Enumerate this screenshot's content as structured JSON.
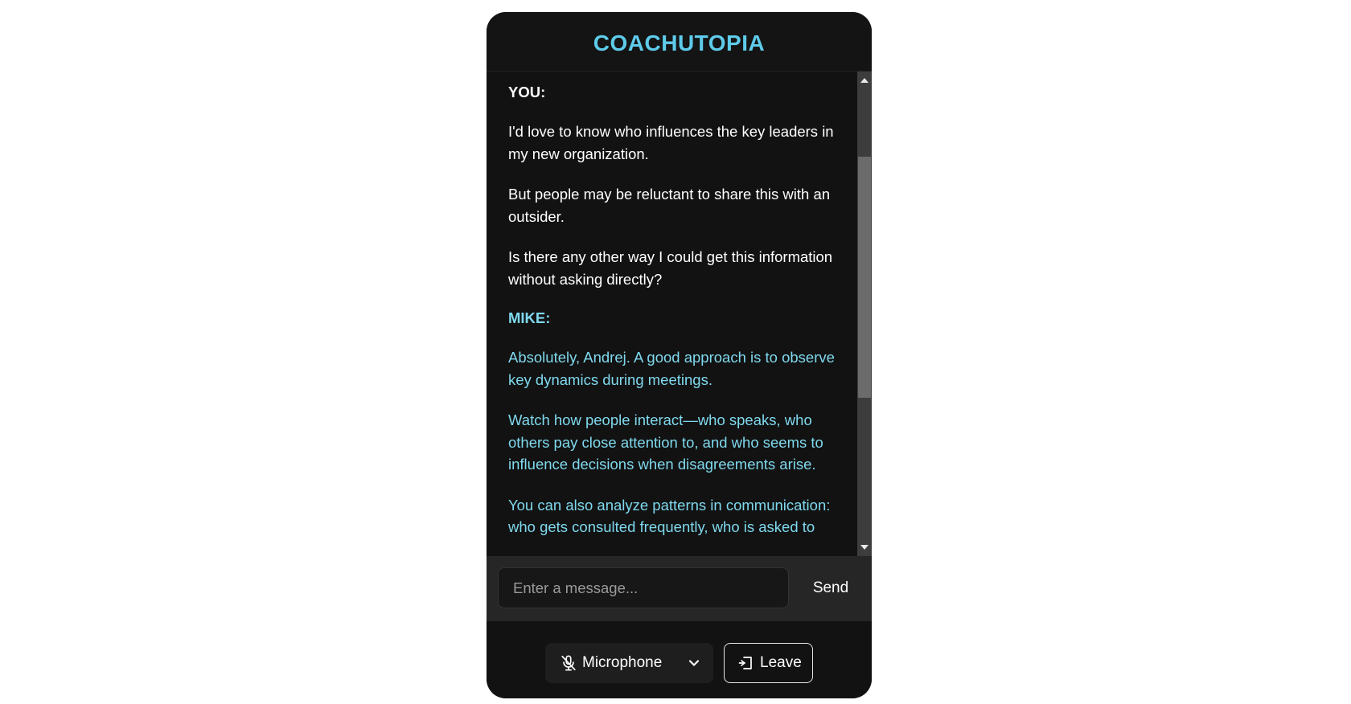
{
  "app": {
    "title": "COACHUTOPIA"
  },
  "conversation": {
    "you_label": "YOU:",
    "you_messages": [
      "I'd love to know who influences the key leaders in my new organization.",
      "But people may be reluctant to share this with an outsider.",
      "Is there any other way I could get this information without asking directly?"
    ],
    "mike_label": "MIKE:",
    "mike_messages": [
      "Absolutely, Andrej. A good approach is to observe key dynamics during meetings.",
      "Watch how people interact—who speaks, who others pay close attention to, and who seems to influence decisions when disagreements arise.",
      "You can also analyze patterns in communication: who gets consulted frequently, who is asked to"
    ]
  },
  "composer": {
    "placeholder": "Enter a message...",
    "value": "",
    "send_label": "Send"
  },
  "controls": {
    "microphone_label": "Microphone",
    "microphone_icon": "mic-off-icon",
    "leave_label": "Leave",
    "leave_icon": "leave-icon"
  },
  "colors": {
    "accent": "#5ecbea",
    "mike_text": "#7fd9ee",
    "panel_bg": "#121212",
    "composer_bg": "#262626"
  }
}
